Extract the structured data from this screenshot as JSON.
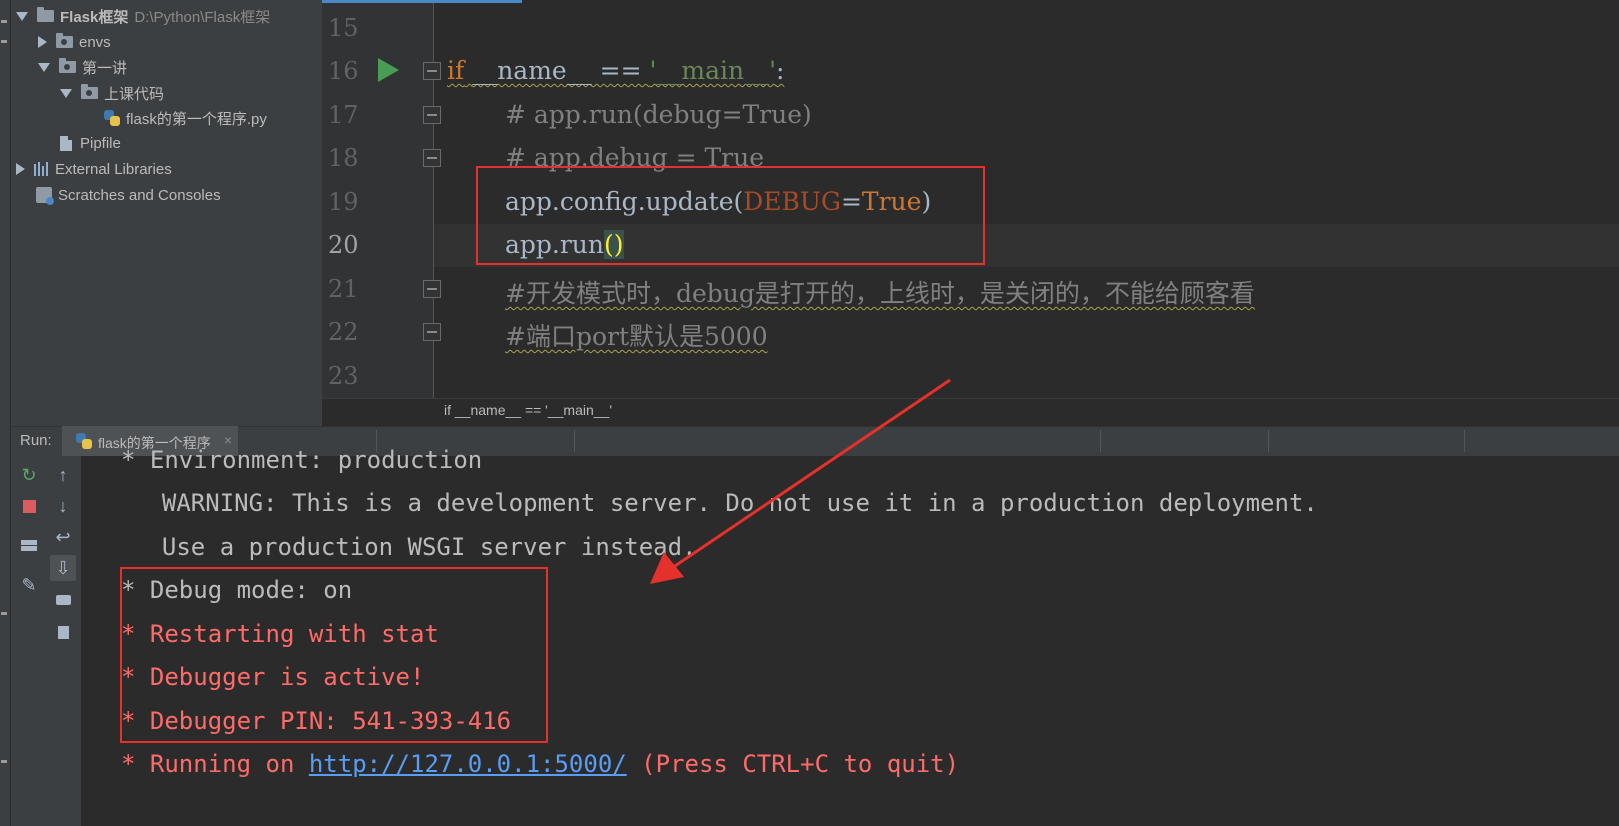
{
  "project": {
    "root_name": "Flask框架",
    "root_path": "D:\\Python\\Flask框架",
    "items": [
      {
        "label": "envs"
      },
      {
        "label": "第一讲"
      },
      {
        "label": "上课代码"
      },
      {
        "label": "flask的第一个程序.py"
      },
      {
        "label": "Pipfile"
      },
      {
        "label": "External Libraries"
      },
      {
        "label": "Scratches and Consoles"
      }
    ]
  },
  "editor": {
    "line_numbers": [
      "15",
      "16",
      "17",
      "18",
      "19",
      "20",
      "21",
      "22",
      "23"
    ],
    "lines": {
      "l16": {
        "kw": "if",
        "dunder_name": "__name__",
        "op": " == ",
        "str": "'__main__'",
        "colon": ":"
      },
      "l17": "# app.run(debug=True)",
      "l18": "# app.debug = True",
      "l19": {
        "obj": "app.config.update(",
        "param": "DEBUG",
        "eq": "=",
        "bool": "True",
        "close": ")"
      },
      "l20": {
        "call": "app.run",
        "parens": "()"
      },
      "l21": "#开发模式时，debug是打开的，上线时，是关闭的，不能给顾客看",
      "l22": "#端口port默认是5000"
    },
    "breadcrumb": "if __name__ == '__main__'"
  },
  "run": {
    "label": "Run:",
    "tab_label": "flask的第一个程序",
    "tab_close": "×",
    "output": {
      "env": "* Environment: production",
      "warning": "  WARNING: This is a development server. Do not use it in a production deployment.",
      "use_wsgi": "  Use a production WSGI server instead.",
      "debug_mode": "* Debug mode: on",
      "restarting": "* Restarting with stat",
      "debugger_active": "* Debugger is active!",
      "debugger_pin": "* Debugger PIN: 541-393-416",
      "running_prefix": "* Running on ",
      "running_url": "http://127.0.0.1:5000/",
      "running_suffix": " (Press CTRL+C to quit)"
    }
  },
  "colors": {
    "annotation_red": "#e5312b",
    "run_green": "#499c54",
    "keyword": "#cc7832",
    "string": "#6a8759",
    "comment": "#808080",
    "error_output": "#ff6b68",
    "link": "#589df6"
  }
}
